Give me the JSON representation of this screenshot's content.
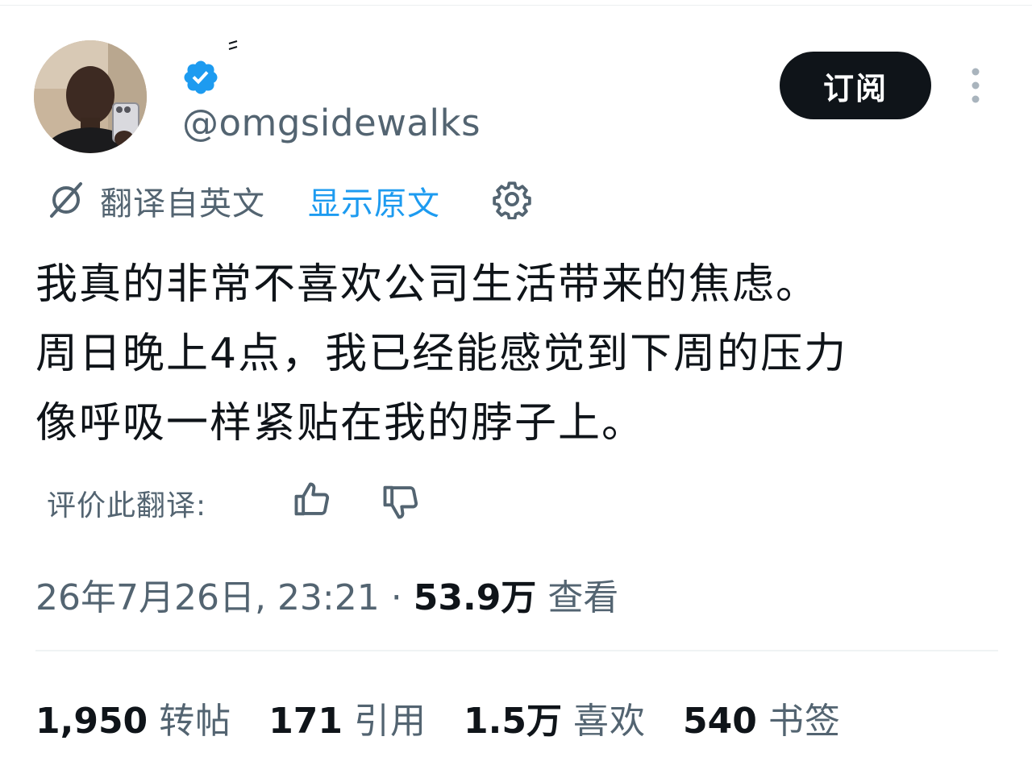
{
  "header": {
    "handle": "@omgsidewalks",
    "subscribe_label": "订阅"
  },
  "translation": {
    "translated_label": "翻译自英文",
    "show_original_label": "显示原文"
  },
  "tweet": {
    "lines": [
      "我真的非常不喜欢公司生活带来的焦虑。",
      "周日晚上4点，我已经能感觉到下周的压力",
      "像呼吸一样紧贴在我的脖子上。"
    ]
  },
  "rating": {
    "label": "评价此翻译:"
  },
  "meta": {
    "timestamp": "26年7月26日, 23:21",
    "separator": "·",
    "views_count": "53.9万",
    "views_label": "查看"
  },
  "stats": [
    {
      "count": "1,950",
      "label": "转帖"
    },
    {
      "count": "171",
      "label": "引用"
    },
    {
      "count": "1.5万",
      "label": "喜欢"
    },
    {
      "count": "540",
      "label": "书签"
    }
  ],
  "icons": {
    "verified": "verified-badge-icon",
    "more": "more-vertical-icon",
    "translate": "translate-icon",
    "settings": "gear-icon",
    "thumb_up": "thumbs-up-icon",
    "thumb_down": "thumbs-down-icon"
  },
  "colors": {
    "accent": "#1d9bf0",
    "text": "#0f1419",
    "muted": "#536471",
    "button_bg": "#0f1419"
  }
}
